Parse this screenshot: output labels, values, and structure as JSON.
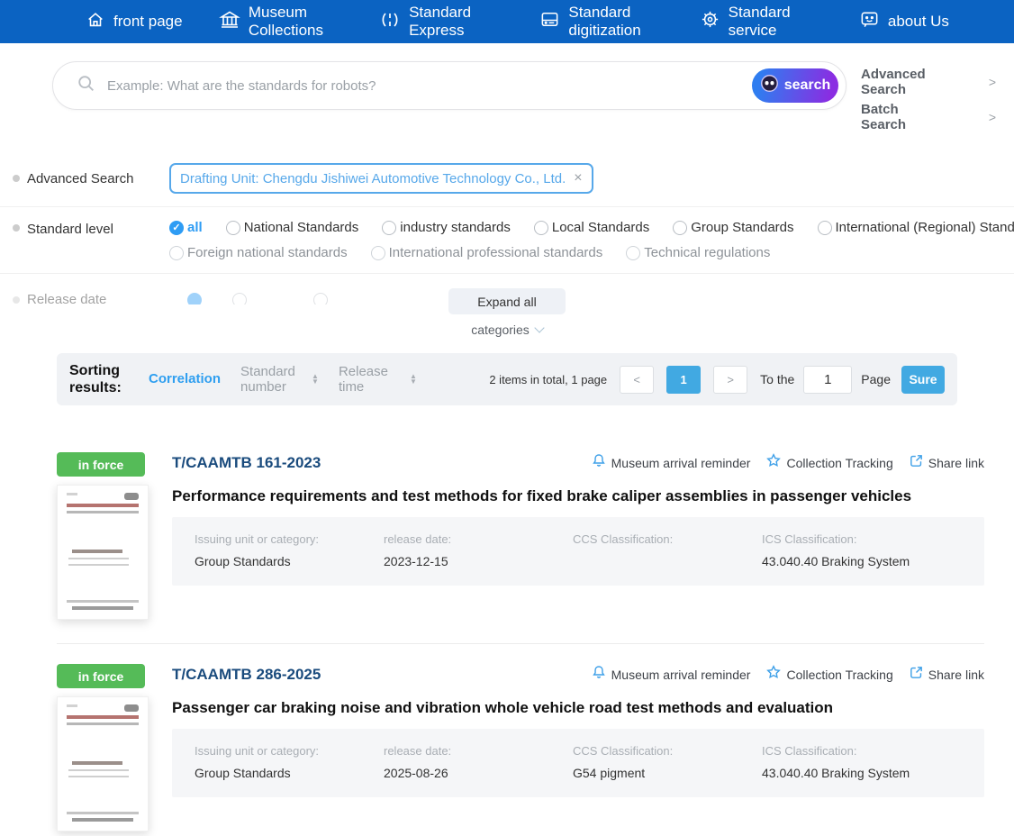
{
  "colors": {
    "nav_blue": "#0b63c2",
    "accent_blue": "#2e9cf4",
    "tag_blue": "#57a8ea",
    "pagination_blue": "#41a9e2",
    "badge_green": "#55bb58",
    "number_navy": "#1a4b7d",
    "search_gradient_start": "#2f7df0",
    "search_gradient_end": "#8a2de2"
  },
  "nav": {
    "items": [
      {
        "label": "front page",
        "icon": "home-icon"
      },
      {
        "label": "Museum Collections",
        "icon": "museum-icon"
      },
      {
        "label": "Standard Express",
        "icon": "express-icon"
      },
      {
        "label": "Standard digitization",
        "icon": "digitization-icon"
      },
      {
        "label": "Standard service",
        "icon": "service-icon"
      },
      {
        "label": "about Us",
        "icon": "chat-smile-icon"
      }
    ]
  },
  "search": {
    "placeholder": "Example: What are the standards for robots?",
    "button_label": "search",
    "advanced_link": "Advanced Search",
    "batch_link": "Batch Search",
    "chevron": ">"
  },
  "filters": {
    "advanced": {
      "label": "Advanced Search",
      "tag": "Drafting Unit: Chengdu Jishiwei Automotive Technology Co., Ltd.",
      "close": "×"
    },
    "level": {
      "label": "Standard level",
      "row1": [
        {
          "label": "all",
          "selected": true
        },
        {
          "label": "National Standards",
          "selected": false
        },
        {
          "label": "industry standards",
          "selected": false
        },
        {
          "label": "Local Standards",
          "selected": false
        },
        {
          "label": "Group Standards",
          "selected": false
        },
        {
          "label": "International (Regional) Standards",
          "selected": false
        }
      ],
      "row2": [
        {
          "label": "Foreign national standards",
          "selected": false
        },
        {
          "label": "International professional standards",
          "selected": false
        },
        {
          "label": "Technical regulations",
          "selected": false
        }
      ],
      "check_glyph": "✓"
    },
    "release_date_label": "Release date",
    "expand_all": "Expand all",
    "categories": "categories"
  },
  "sorting": {
    "label": "Sorting results:",
    "tabs": [
      {
        "label": "Correlation",
        "active": true
      },
      {
        "label": "Standard number",
        "active": false
      },
      {
        "label": "Release time",
        "active": false
      }
    ],
    "sort_arrows": {
      "up": "▲",
      "down": "▼"
    },
    "total": "2 items in total, 1 page",
    "prev": "<",
    "page": "1",
    "next": ">",
    "to_the": "To the",
    "goto_value": "1",
    "page_word": "Page",
    "confirm": "Sure"
  },
  "results": [
    {
      "status": "in force",
      "number": "T/CAAMTB 161-2023",
      "title": "Performance requirements and test methods for fixed brake caliper assemblies in passenger vehicles",
      "actions": [
        {
          "label": "Museum arrival reminder",
          "icon": "bell-icon"
        },
        {
          "label": "Collection Tracking",
          "icon": "star-icon"
        },
        {
          "label": "Share link",
          "icon": "share-icon"
        }
      ],
      "details": [
        {
          "label": "Issuing unit or category:",
          "value": "Group Standards"
        },
        {
          "label": "release date:",
          "value": "2023-12-15"
        },
        {
          "label": "CCS Classification:",
          "value": ""
        },
        {
          "label": "ICS Classification:",
          "value": "43.040.40 Braking System"
        }
      ]
    },
    {
      "status": "in force",
      "number": "T/CAAMTB 286-2025",
      "title": "Passenger car braking noise and vibration whole vehicle road test methods and evaluation",
      "actions": [
        {
          "label": "Museum arrival reminder",
          "icon": "bell-icon"
        },
        {
          "label": "Collection Tracking",
          "icon": "star-icon"
        },
        {
          "label": "Share link",
          "icon": "share-icon"
        }
      ],
      "details": [
        {
          "label": "Issuing unit or category:",
          "value": "Group Standards"
        },
        {
          "label": "release date:",
          "value": "2025-08-26"
        },
        {
          "label": "CCS Classification:",
          "value": "G54 pigment"
        },
        {
          "label": "ICS Classification:",
          "value": "43.040.40 Braking System"
        }
      ]
    }
  ]
}
